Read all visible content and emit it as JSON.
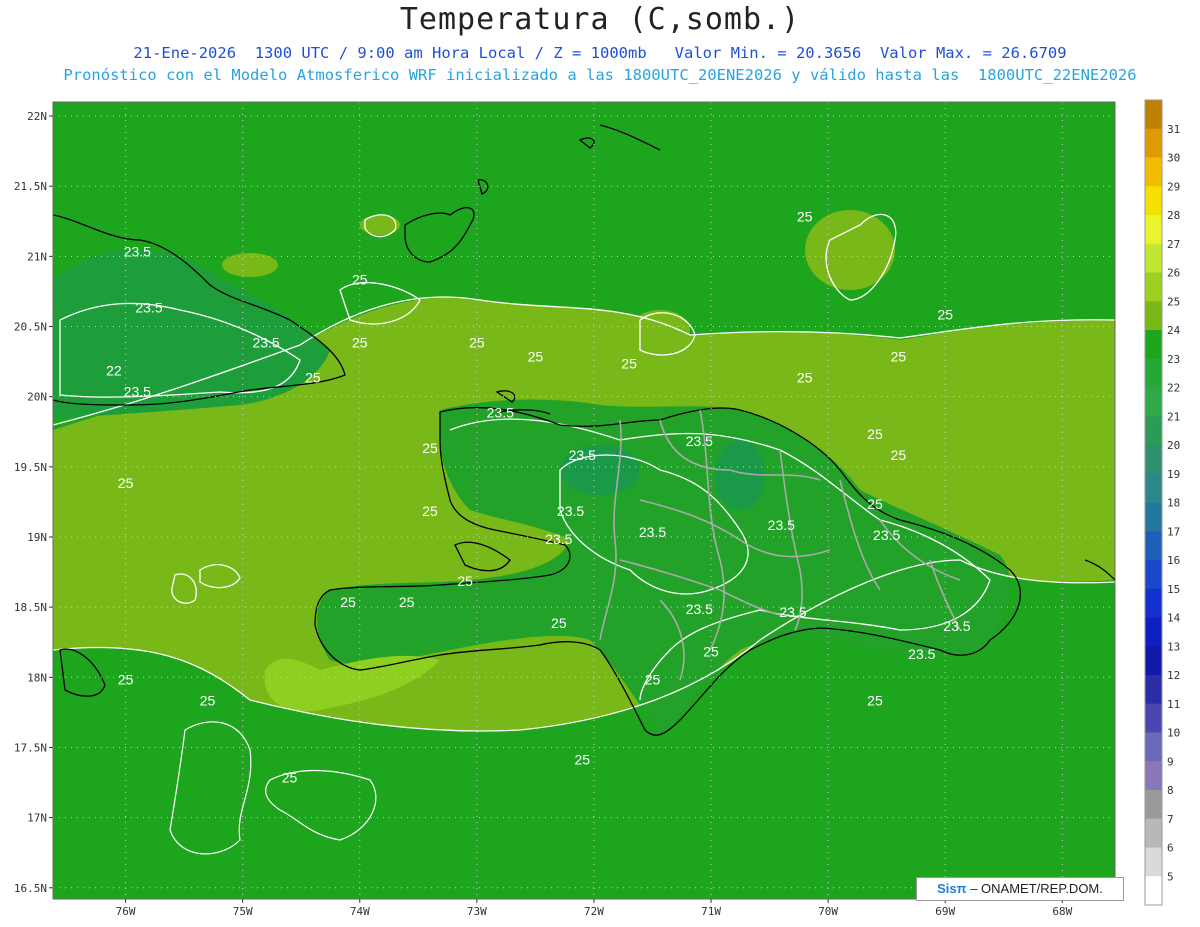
{
  "title": "Temperatura (C,somb.)",
  "subtitle_line1": "21-Ene-2026  1300 UTC / 9:00 am Hora Local / Z = 1000mb   Valor Min. = 20.3656  Valor Max. = 26.6709",
  "subtitle_line2": "Pronóstico con el Modelo Atmosferico WRF inicializado a las 1800UTC_20ENE2026 y válido hasta las  1800UTC_22ENE2026",
  "lat_labels": [
    "22N",
    "21.5N",
    "21N",
    "20.5N",
    "20N",
    "19.5N",
    "19N",
    "18.5N",
    "18N",
    "17.5N",
    "17N",
    "16.5N"
  ],
  "lon_labels": [
    "76W",
    "75W",
    "74W",
    "73W",
    "72W",
    "71W",
    "70W",
    "69W",
    "68W"
  ],
  "colorbar": {
    "labels": [
      "31",
      "30",
      "29",
      "28",
      "27",
      "26",
      "25",
      "24",
      "23",
      "22",
      "21",
      "20",
      "19",
      "18",
      "17",
      "16",
      "15",
      "14",
      "13",
      "12",
      "11",
      "10",
      "9",
      "8",
      "7",
      "6",
      "5"
    ],
    "colors": [
      "#c08000",
      "#e09a00",
      "#f2bd00",
      "#f5e000",
      "#e8f530",
      "#c0e830",
      "#9ed020",
      "#78b818",
      "#1ea51e",
      "#26a834",
      "#2ea848",
      "#2e9a58",
      "#2e9070",
      "#2a8888",
      "#2478a0",
      "#1e60b8",
      "#1a48c8",
      "#1430d0",
      "#1020c0",
      "#1018a8",
      "#2c2ca8",
      "#4848b0",
      "#6a6ab8",
      "#8878b8",
      "#9a9a9a",
      "#b8b8b8",
      "#dadada",
      "#ffffff"
    ]
  },
  "contour_labels": [
    {
      "text": "23.5",
      "lon": -75.9,
      "lat": 21.0
    },
    {
      "text": "23.5",
      "lon": -75.8,
      "lat": 20.6
    },
    {
      "text": "23.5",
      "lon": -74.8,
      "lat": 20.35
    },
    {
      "text": "22",
      "lon": -76.1,
      "lat": 20.15
    },
    {
      "text": "23.5",
      "lon": -75.9,
      "lat": 20.0
    },
    {
      "text": "25",
      "lon": -74.0,
      "lat": 20.8
    },
    {
      "text": "25",
      "lon": -74.0,
      "lat": 20.35
    },
    {
      "text": "25",
      "lon": -74.4,
      "lat": 20.1
    },
    {
      "text": "25",
      "lon": -73.0,
      "lat": 20.35
    },
    {
      "text": "25",
      "lon": -72.5,
      "lat": 20.25
    },
    {
      "text": "25",
      "lon": -71.7,
      "lat": 20.2
    },
    {
      "text": "25",
      "lon": -70.2,
      "lat": 20.1
    },
    {
      "text": "25",
      "lon": -70.2,
      "lat": 21.25
    },
    {
      "text": "25",
      "lon": -69.0,
      "lat": 20.55
    },
    {
      "text": "25",
      "lon": -69.4,
      "lat": 20.25
    },
    {
      "text": "25",
      "lon": -69.6,
      "lat": 19.7
    },
    {
      "text": "25",
      "lon": -69.4,
      "lat": 19.55
    },
    {
      "text": "25",
      "lon": -73.4,
      "lat": 19.6
    },
    {
      "text": "25",
      "lon": -73.4,
      "lat": 19.15
    },
    {
      "text": "25",
      "lon": -76.0,
      "lat": 19.35
    },
    {
      "text": "23.5",
      "lon": -72.8,
      "lat": 19.85
    },
    {
      "text": "23.5",
      "lon": -71.1,
      "lat": 19.65
    },
    {
      "text": "23.5",
      "lon": -72.1,
      "lat": 19.55
    },
    {
      "text": "23.5",
      "lon": -72.2,
      "lat": 19.15
    },
    {
      "text": "23.5",
      "lon": -72.3,
      "lat": 18.95
    },
    {
      "text": "23.5",
      "lon": -71.5,
      "lat": 19.0
    },
    {
      "text": "23.5",
      "lon": -70.4,
      "lat": 19.05
    },
    {
      "text": "23.5",
      "lon": -69.5,
      "lat": 18.98
    },
    {
      "text": "25",
      "lon": -69.6,
      "lat": 19.2
    },
    {
      "text": "25",
      "lon": -73.1,
      "lat": 18.65
    },
    {
      "text": "25",
      "lon": -74.1,
      "lat": 18.5
    },
    {
      "text": "25",
      "lon": -73.6,
      "lat": 18.5
    },
    {
      "text": "25",
      "lon": -72.3,
      "lat": 18.35
    },
    {
      "text": "23.5",
      "lon": -71.1,
      "lat": 18.45
    },
    {
      "text": "23.5",
      "lon": -70.3,
      "lat": 18.43
    },
    {
      "text": "23.5",
      "lon": -68.9,
      "lat": 18.33
    },
    {
      "text": "23.5",
      "lon": -69.2,
      "lat": 18.13
    },
    {
      "text": "25",
      "lon": -71.0,
      "lat": 18.15
    },
    {
      "text": "25",
      "lon": -71.5,
      "lat": 17.95
    },
    {
      "text": "25",
      "lon": -69.6,
      "lat": 17.8
    },
    {
      "text": "25",
      "lon": -72.1,
      "lat": 17.38
    },
    {
      "text": "25",
      "lon": -76.0,
      "lat": 17.95
    },
    {
      "text": "25",
      "lon": -75.3,
      "lat": 17.8
    },
    {
      "text": "25",
      "lon": -74.6,
      "lat": 17.25
    }
  ],
  "credit": {
    "brand": "Sisπ",
    "text": "– ONAMET/REP.DOM."
  }
}
